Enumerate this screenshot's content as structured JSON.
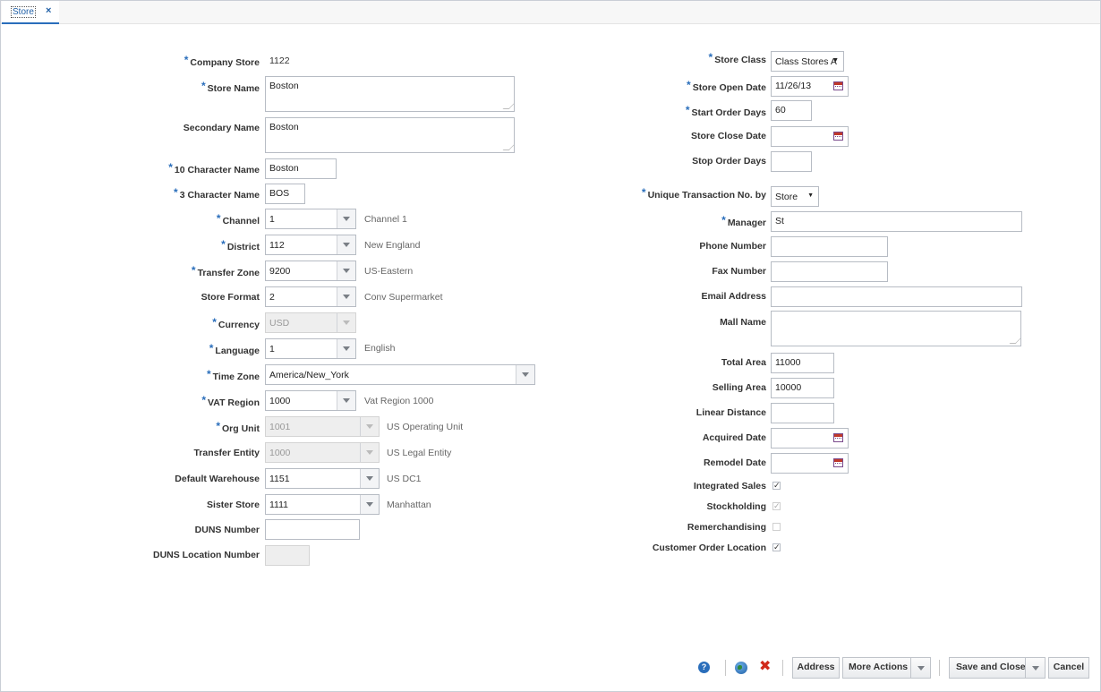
{
  "tab": {
    "label": "Store",
    "close": "×"
  },
  "left": {
    "company_store": {
      "label": "Company Store",
      "value": "1122"
    },
    "store_name": {
      "label": "Store Name",
      "value": "Boston"
    },
    "secondary_name": {
      "label": "Secondary Name",
      "value": "Boston"
    },
    "ten_char_name": {
      "label": "10 Character Name",
      "value": "Boston"
    },
    "three_char_name": {
      "label": "3 Character Name",
      "value": "BOS"
    },
    "channel": {
      "label": "Channel",
      "value": "1",
      "desc": "Channel 1"
    },
    "district": {
      "label": "District",
      "value": "112",
      "desc": "New England"
    },
    "transfer_zone": {
      "label": "Transfer Zone",
      "value": "9200",
      "desc": "US-Eastern"
    },
    "store_format": {
      "label": "Store Format",
      "value": "2",
      "desc": "Conv Supermarket"
    },
    "currency": {
      "label": "Currency",
      "value": "USD"
    },
    "language": {
      "label": "Language",
      "value": "1",
      "desc": "English"
    },
    "time_zone": {
      "label": "Time Zone",
      "value": "America/New_York"
    },
    "vat_region": {
      "label": "VAT Region",
      "value": "1000",
      "desc": "Vat Region 1000"
    },
    "org_unit": {
      "label": "Org Unit",
      "value": "1001",
      "desc": "US Operating Unit"
    },
    "transfer_entity": {
      "label": "Transfer Entity",
      "value": "1000",
      "desc": "US Legal Entity"
    },
    "default_warehouse": {
      "label": "Default Warehouse",
      "value": "1151",
      "desc": "US DC1"
    },
    "sister_store": {
      "label": "Sister Store",
      "value": "1111",
      "desc": "Manhattan"
    },
    "duns_number": {
      "label": "DUNS Number",
      "value": ""
    },
    "duns_location_number": {
      "label": "DUNS Location Number",
      "value": ""
    }
  },
  "right": {
    "store_class": {
      "label": "Store Class",
      "value": "Class Stores A"
    },
    "store_open_date": {
      "label": "Store Open Date",
      "value": "11/26/13"
    },
    "start_order_days": {
      "label": "Start Order Days",
      "value": "60"
    },
    "store_close_date": {
      "label": "Store Close Date",
      "value": ""
    },
    "stop_order_days": {
      "label": "Stop Order Days",
      "value": ""
    },
    "unique_txn": {
      "label": "Unique Transaction No. by",
      "value": "Store"
    },
    "manager": {
      "label": "Manager",
      "value": "St"
    },
    "phone_number": {
      "label": "Phone Number",
      "value": ""
    },
    "fax_number": {
      "label": "Fax Number",
      "value": ""
    },
    "email_address": {
      "label": "Email Address",
      "value": ""
    },
    "mall_name": {
      "label": "Mall Name",
      "value": ""
    },
    "total_area": {
      "label": "Total Area",
      "value": "11000"
    },
    "selling_area": {
      "label": "Selling Area",
      "value": "10000"
    },
    "linear_distance": {
      "label": "Linear Distance",
      "value": ""
    },
    "acquired_date": {
      "label": "Acquired Date",
      "value": ""
    },
    "remodel_date": {
      "label": "Remodel Date",
      "value": ""
    },
    "integrated_sales": {
      "label": "Integrated Sales",
      "checked": true
    },
    "stockholding": {
      "label": "Stockholding",
      "checked": true
    },
    "remerchandising": {
      "label": "Remerchandising",
      "checked": false
    },
    "customer_order_location": {
      "label": "Customer Order Location",
      "checked": true
    }
  },
  "required_marker": "*",
  "footer": {
    "help": "?",
    "address": "Address",
    "more_actions": "More Actions",
    "save_and_close": "Save and Close",
    "cancel": "Cancel"
  },
  "icons": [
    "help-icon",
    "globe-icon",
    "close-x-icon",
    "calendar-icon",
    "dropdown-arrow-icon",
    "checkmark-icon"
  ]
}
